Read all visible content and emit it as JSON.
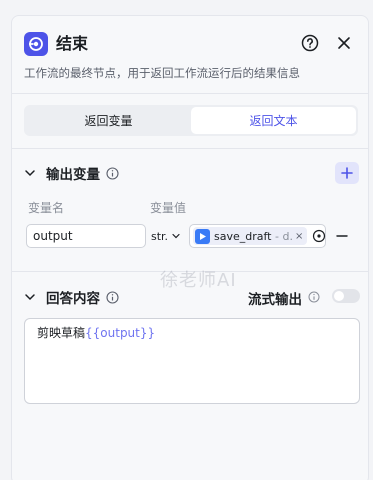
{
  "header": {
    "title": "结束",
    "description": "工作流的最终节点，用于返回工作流运行后的结果信息"
  },
  "tabs": [
    {
      "label": "返回变量",
      "active": false
    },
    {
      "label": "返回文本",
      "active": true
    }
  ],
  "output_section": {
    "title": "输出变量",
    "col_name": "变量名",
    "col_value": "变量值",
    "row": {
      "name": "output",
      "type": "str.",
      "ref_name": "save_draft",
      "ref_sep": " - d.",
      "remove": "×"
    }
  },
  "watermark": "徐老师AI",
  "answer_section": {
    "title": "回答内容",
    "stream_label": "流式输出",
    "stream_enabled": false,
    "content_prefix": "剪映草稿",
    "content_var": "{{output}}"
  },
  "colors": {
    "accent": "#4d53e8",
    "variable": "#6f74f0"
  }
}
